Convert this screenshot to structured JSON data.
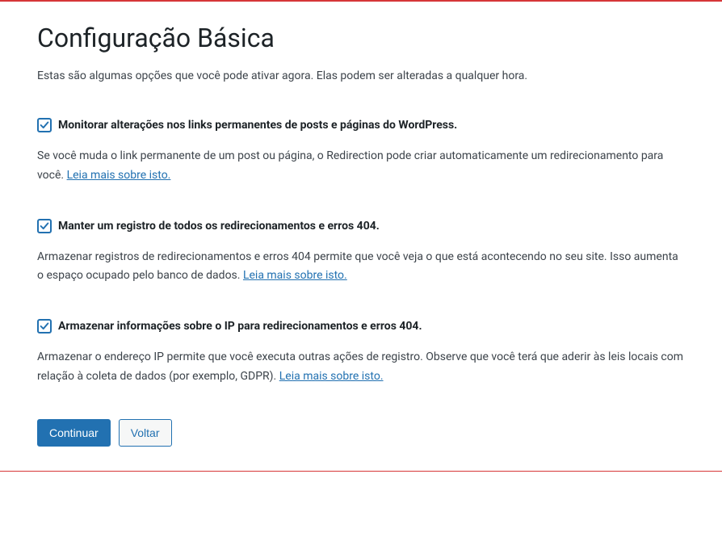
{
  "header": {
    "title": "Configuração Básica",
    "intro": "Estas são algumas opções que você pode ativar agora. Elas podem ser alteradas a qualquer hora."
  },
  "options": {
    "monitor": {
      "checked": true,
      "label": "Monitorar alterações nos links permanentes de posts e páginas do WordPress.",
      "description_before": "Se você muda o link permanente de um post ou página, o Redirection pode criar automaticamente um redirecionamento para você. ",
      "link_text": "Leia mais sobre isto."
    },
    "log": {
      "checked": true,
      "label": "Manter um registro de todos os redirecionamentos e erros 404.",
      "description_before": "Armazenar registros de redirecionamentos e erros 404 permite que você veja o que está acontecendo no seu site. Isso aumenta o espaço ocupado pelo banco de dados. ",
      "link_text": "Leia mais sobre isto."
    },
    "ip": {
      "checked": true,
      "label": "Armazenar informações sobre o IP para redirecionamentos e erros 404.",
      "description_before": "Armazenar o endereço IP permite que você executa outras ações de registro. Observe que você terá que aderir às leis locais com relação à coleta de dados (por exemplo, GDPR). ",
      "link_text": "Leia mais sobre isto."
    }
  },
  "buttons": {
    "continue": "Continuar",
    "back": "Voltar"
  }
}
